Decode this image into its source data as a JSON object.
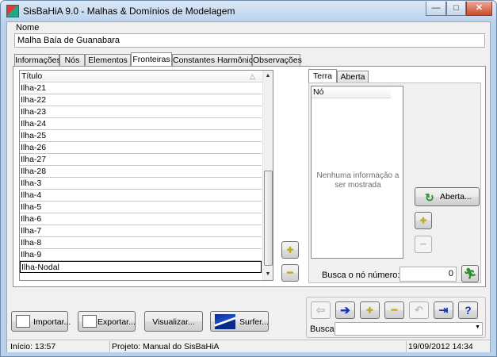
{
  "window": {
    "title": "SisBaHiA 9.0 - Malhas & Domínios de Modelagem"
  },
  "controls": {
    "minimize": "—",
    "maximize": "□",
    "close": "✕"
  },
  "name_field": {
    "label": "Nome",
    "value": "Malha Baía de Guanabara"
  },
  "tabs": [
    "Informações",
    "Nós",
    "Elementos",
    "Fronteiras",
    "Constantes Harmônicas",
    "Observações"
  ],
  "active_tab": "Fronteiras",
  "boundary_list": {
    "header": "Título",
    "sort_indicator": "△",
    "rows": [
      "Ilha-21",
      "Ilha-22",
      "Ilha-23",
      "Ilha-24",
      "Ilha-25",
      "Ilha-26",
      "Ilha-27",
      "Ilha-28",
      "Ilha-3",
      "Ilha-4",
      "Ilha-5",
      "Ilha-6",
      "Ilha-7",
      "Ilha-8",
      "Ilha-9",
      "Ilha-Nodal"
    ],
    "selected": "Ilha-Nodal"
  },
  "list_buttons": {
    "add": "+",
    "remove": "−"
  },
  "sub_tabs": [
    "Terra",
    "Aberta"
  ],
  "active_sub_tab": "Terra",
  "node_list": {
    "header": "Nó",
    "empty_message_line1": "Nenhuma informação a",
    "empty_message_line2": "ser mostrada"
  },
  "aberta_button": {
    "label": "Aberta..."
  },
  "node_buttons": {
    "add": "+",
    "remove": "−"
  },
  "search_node": {
    "label": "Busca o nó número:",
    "value": "0"
  },
  "bottom_buttons": {
    "import": "Importar...",
    "export": "Exportar...",
    "view": "Visualizar...",
    "surfer": "Surfer..."
  },
  "nav_toolbar": {
    "back": "⇦",
    "forward": "➔",
    "add": "+",
    "remove": "−",
    "undo": "↶",
    "exit": "⇥",
    "help": "?"
  },
  "search": {
    "label": "Busca:",
    "value": ""
  },
  "status": {
    "start": "Início: 13:57",
    "project": "Projeto: Manual do SisBaHiA",
    "datetime": "19/09/2012 14:34"
  },
  "colors": {
    "title_bg": "#c4d8ee",
    "accent_green": "#2d8d2d",
    "nav_blue": "#1535b8",
    "plus_yellow": "#c9b000"
  }
}
